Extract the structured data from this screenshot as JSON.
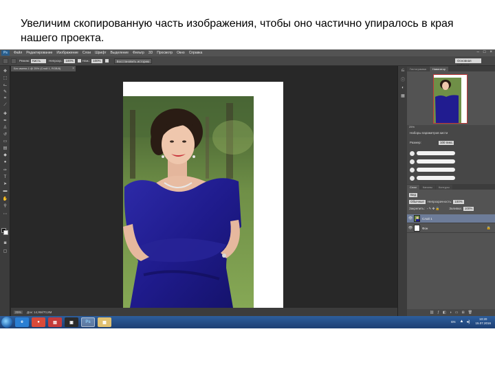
{
  "caption": "Увеличим скопированную часть изображения, чтобы оно частично упиралось в края нашего проекта.",
  "menubar": {
    "logo": "Ps",
    "items": [
      "Файл",
      "Редактирование",
      "Изображение",
      "Слои",
      "Шрифт",
      "Выделение",
      "Фильтр",
      "3D",
      "Просмотр",
      "Окно",
      "Справка"
    ],
    "controls": [
      "–",
      "□",
      "×"
    ]
  },
  "options": {
    "mode_label": "Режим:",
    "mode_value": "Кисть",
    "opacity_label": "Непрозр.:",
    "opacity_value": "100%",
    "flow_label": "Наж.:",
    "flow_value": "100%",
    "restore_button": "Восстановить историю",
    "workspace_value": "Основная рабочая"
  },
  "document_tab": {
    "title": "Без имени-1 @ 25% (Слой 1, RGB/8)",
    "close": "×"
  },
  "status": {
    "zoom": "25%",
    "doc_info": "Док: 14,9M/70,8M"
  },
  "panels": {
    "navigator_tabs": [
      "Гистограмма",
      "Навигатор"
    ],
    "nav_zoom": "25%",
    "brush_presets_title": "Наборы параметров кисти",
    "brush_size_label": "Размер:",
    "brush_size_value": "100 пикс.",
    "layers_tabs": [
      "Слои",
      "Каналы",
      "Контуры"
    ],
    "kind_label": "Вид",
    "blend_mode": "Обычные",
    "opacity_label": "Непрозрачность:",
    "opacity_value": "100%",
    "lock_label": "Закрепить:",
    "fill_label": "Заливка:",
    "fill_value": "100%",
    "layers": [
      {
        "name": "Слой 1",
        "selected": true
      },
      {
        "name": "Фон",
        "selected": false
      }
    ]
  },
  "taskbar": {
    "apps": [
      "e",
      "●",
      "▤",
      "▣",
      "Ps",
      "▦"
    ],
    "language": "EN",
    "time": "10:20",
    "date": "15.07.2016"
  },
  "icons": {
    "eye": "👁",
    "lock": "🔒"
  }
}
